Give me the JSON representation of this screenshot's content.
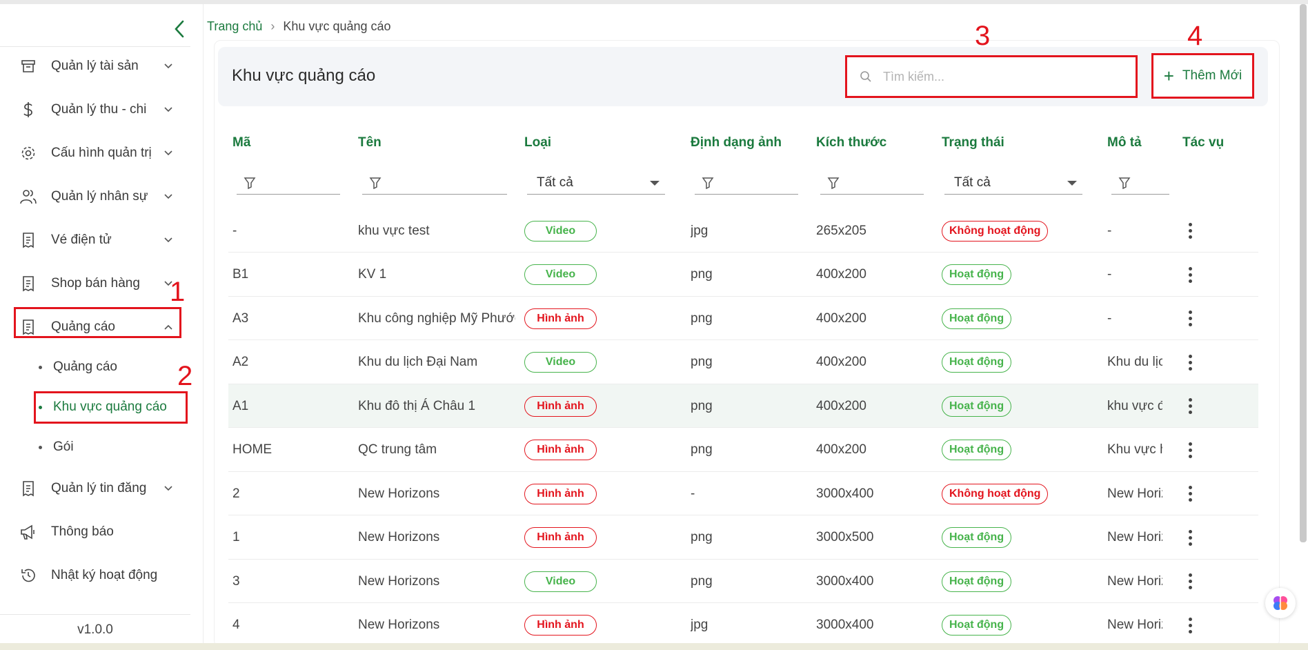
{
  "sidebar": {
    "items": [
      {
        "label": "Quản lý tài sản"
      },
      {
        "label": "Quản lý thu - chi"
      },
      {
        "label": "Cấu hình quản trị"
      },
      {
        "label": "Quản lý nhân sự"
      },
      {
        "label": "Vé điện tử"
      },
      {
        "label": "Shop bán hàng"
      },
      {
        "label": "Quảng cáo"
      },
      {
        "label": "Quản lý tin đăng"
      },
      {
        "label": "Thông báo"
      },
      {
        "label": "Nhật ký hoạt động"
      }
    ],
    "sub_items": [
      {
        "label": "Quảng cáo"
      },
      {
        "label": "Khu vực quảng cáo"
      },
      {
        "label": "Gói"
      }
    ],
    "version": "v1.0.0"
  },
  "breadcrumb": {
    "home": "Trang chủ",
    "current": "Khu vực quảng cáo"
  },
  "header": {
    "title": "Khu vực quảng cáo",
    "search_placeholder": "Tìm kiếm...",
    "add_label": "Thêm Mới"
  },
  "annotations": [
    "1",
    "2",
    "3",
    "4"
  ],
  "table": {
    "columns": [
      "Mã",
      "Tên",
      "Loại",
      "Định dạng ảnh",
      "Kích thước",
      "Trạng thái",
      "Mô tả",
      "Tác vụ"
    ],
    "filters": {
      "type_value": "Tất cả",
      "status_value": "Tất cả"
    },
    "rows": [
      {
        "code": "-",
        "name": "khu vực test",
        "type": "Video",
        "format": "jpg",
        "size": "265x205",
        "status": "Không hoạt động",
        "desc": "-"
      },
      {
        "code": "B1",
        "name": "KV 1",
        "type": "Video",
        "format": "png",
        "size": "400x200",
        "status": "Hoạt động",
        "desc": "-"
      },
      {
        "code": "A3",
        "name": "Khu công nghiệp Mỹ Phước",
        "type": "Hình ảnh",
        "format": "png",
        "size": "400x200",
        "status": "Hoạt động",
        "desc": "-"
      },
      {
        "code": "A2",
        "name": "Khu du lịch Đại Nam",
        "type": "Video",
        "format": "png",
        "size": "400x200",
        "status": "Hoạt động",
        "desc": "Khu du lịch"
      },
      {
        "code": "A1",
        "name": "Khu đô thị Á Châu 1",
        "type": "Hình ảnh",
        "format": "png",
        "size": "400x200",
        "status": "Hoạt động",
        "desc": "khu vực đô"
      },
      {
        "code": "HOME",
        "name": "QC trung tâm",
        "type": "Hình ảnh",
        "format": "png",
        "size": "400x200",
        "status": "Hoạt động",
        "desc": "Khu vực hi"
      },
      {
        "code": "2",
        "name": "New Horizons",
        "type": "Hình ảnh",
        "format": "-",
        "size": "3000x400",
        "status": "Không hoạt động",
        "desc": "New Horizo"
      },
      {
        "code": "1",
        "name": "New Horizons",
        "type": "Hình ảnh",
        "format": "png",
        "size": "3000x500",
        "status": "Hoạt động",
        "desc": "New Horizo"
      },
      {
        "code": "3",
        "name": "New Horizons",
        "type": "Video",
        "format": "png",
        "size": "3000x400",
        "status": "Hoạt động",
        "desc": "New Horizo"
      },
      {
        "code": "4",
        "name": "New Horizons",
        "type": "Hình ảnh",
        "format": "jpg",
        "size": "3000x400",
        "status": "Hoạt động",
        "desc": "New Horizo"
      }
    ]
  },
  "colors": {
    "brand": "#1b7a3e",
    "danger": "#e3141d",
    "success": "#46b34b"
  }
}
